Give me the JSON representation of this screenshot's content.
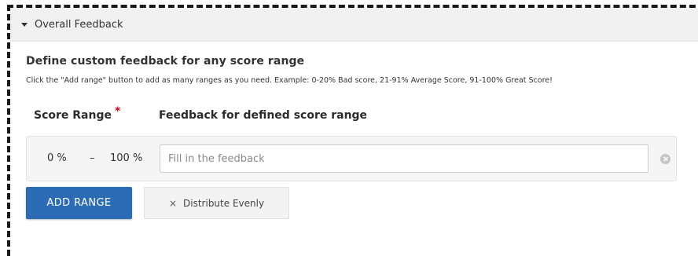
{
  "panel": {
    "title": "Overall Feedback"
  },
  "section": {
    "title": "Define custom feedback for any score range",
    "description": "Click the \"Add range\" button to add as many ranges as you need. Example: 0-20% Bad score, 21-91% Average Score, 91-100% Great Score!"
  },
  "columns": {
    "score_range": "Score Range",
    "required_marker": "*",
    "feedback": "Feedback for defined score range"
  },
  "ranges": [
    {
      "from": "0 %",
      "separator": "–",
      "to": "100 %",
      "feedback_value": "",
      "feedback_placeholder": "Fill in the feedback"
    }
  ],
  "buttons": {
    "add_range": "ADD RANGE",
    "distribute_icon": "×",
    "distribute_evenly": "Distribute Evenly"
  },
  "colors": {
    "primary_button": "#2b6cb5",
    "required_star": "#d0021b",
    "header_bg": "#f1f1f1"
  }
}
